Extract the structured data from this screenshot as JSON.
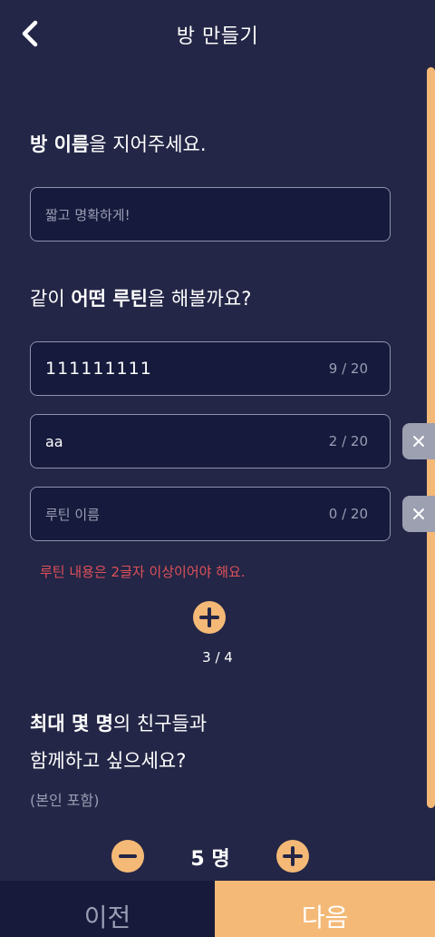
{
  "header": {
    "title": "방 만들기"
  },
  "room": {
    "title_bold": "방 이름",
    "title_rest": "을 지어주세요.",
    "name_placeholder": "짧고 명확하게!",
    "name_value": ""
  },
  "routines": {
    "title_prefix": "같이 ",
    "title_bold": "어떤 루틴",
    "title_rest": "을 해볼까요?",
    "items": [
      {
        "value": "111111111",
        "placeholder": "",
        "counter": "9 / 20",
        "deletable": false
      },
      {
        "value": "aa",
        "placeholder": "",
        "counter": "2 / 20",
        "deletable": true
      },
      {
        "value": "",
        "placeholder": "루틴 이름",
        "counter": "0 / 20",
        "deletable": true
      }
    ],
    "error": "루틴 내용은 2글자 이상이어야 해요.",
    "count_label": "3 / 4"
  },
  "members": {
    "title_bold": "최대 몇 명",
    "title_rest": "의 친구들과",
    "title_line2": "함께하고 싶으세요?",
    "hint": "(본인 포함)",
    "value_label": "5 명"
  },
  "footer": {
    "prev_label": "이전",
    "next_label": "다음"
  },
  "colors": {
    "background": "#232646",
    "accent": "#f4b977",
    "error": "#e0505a",
    "input_bg": "#161a3c"
  }
}
